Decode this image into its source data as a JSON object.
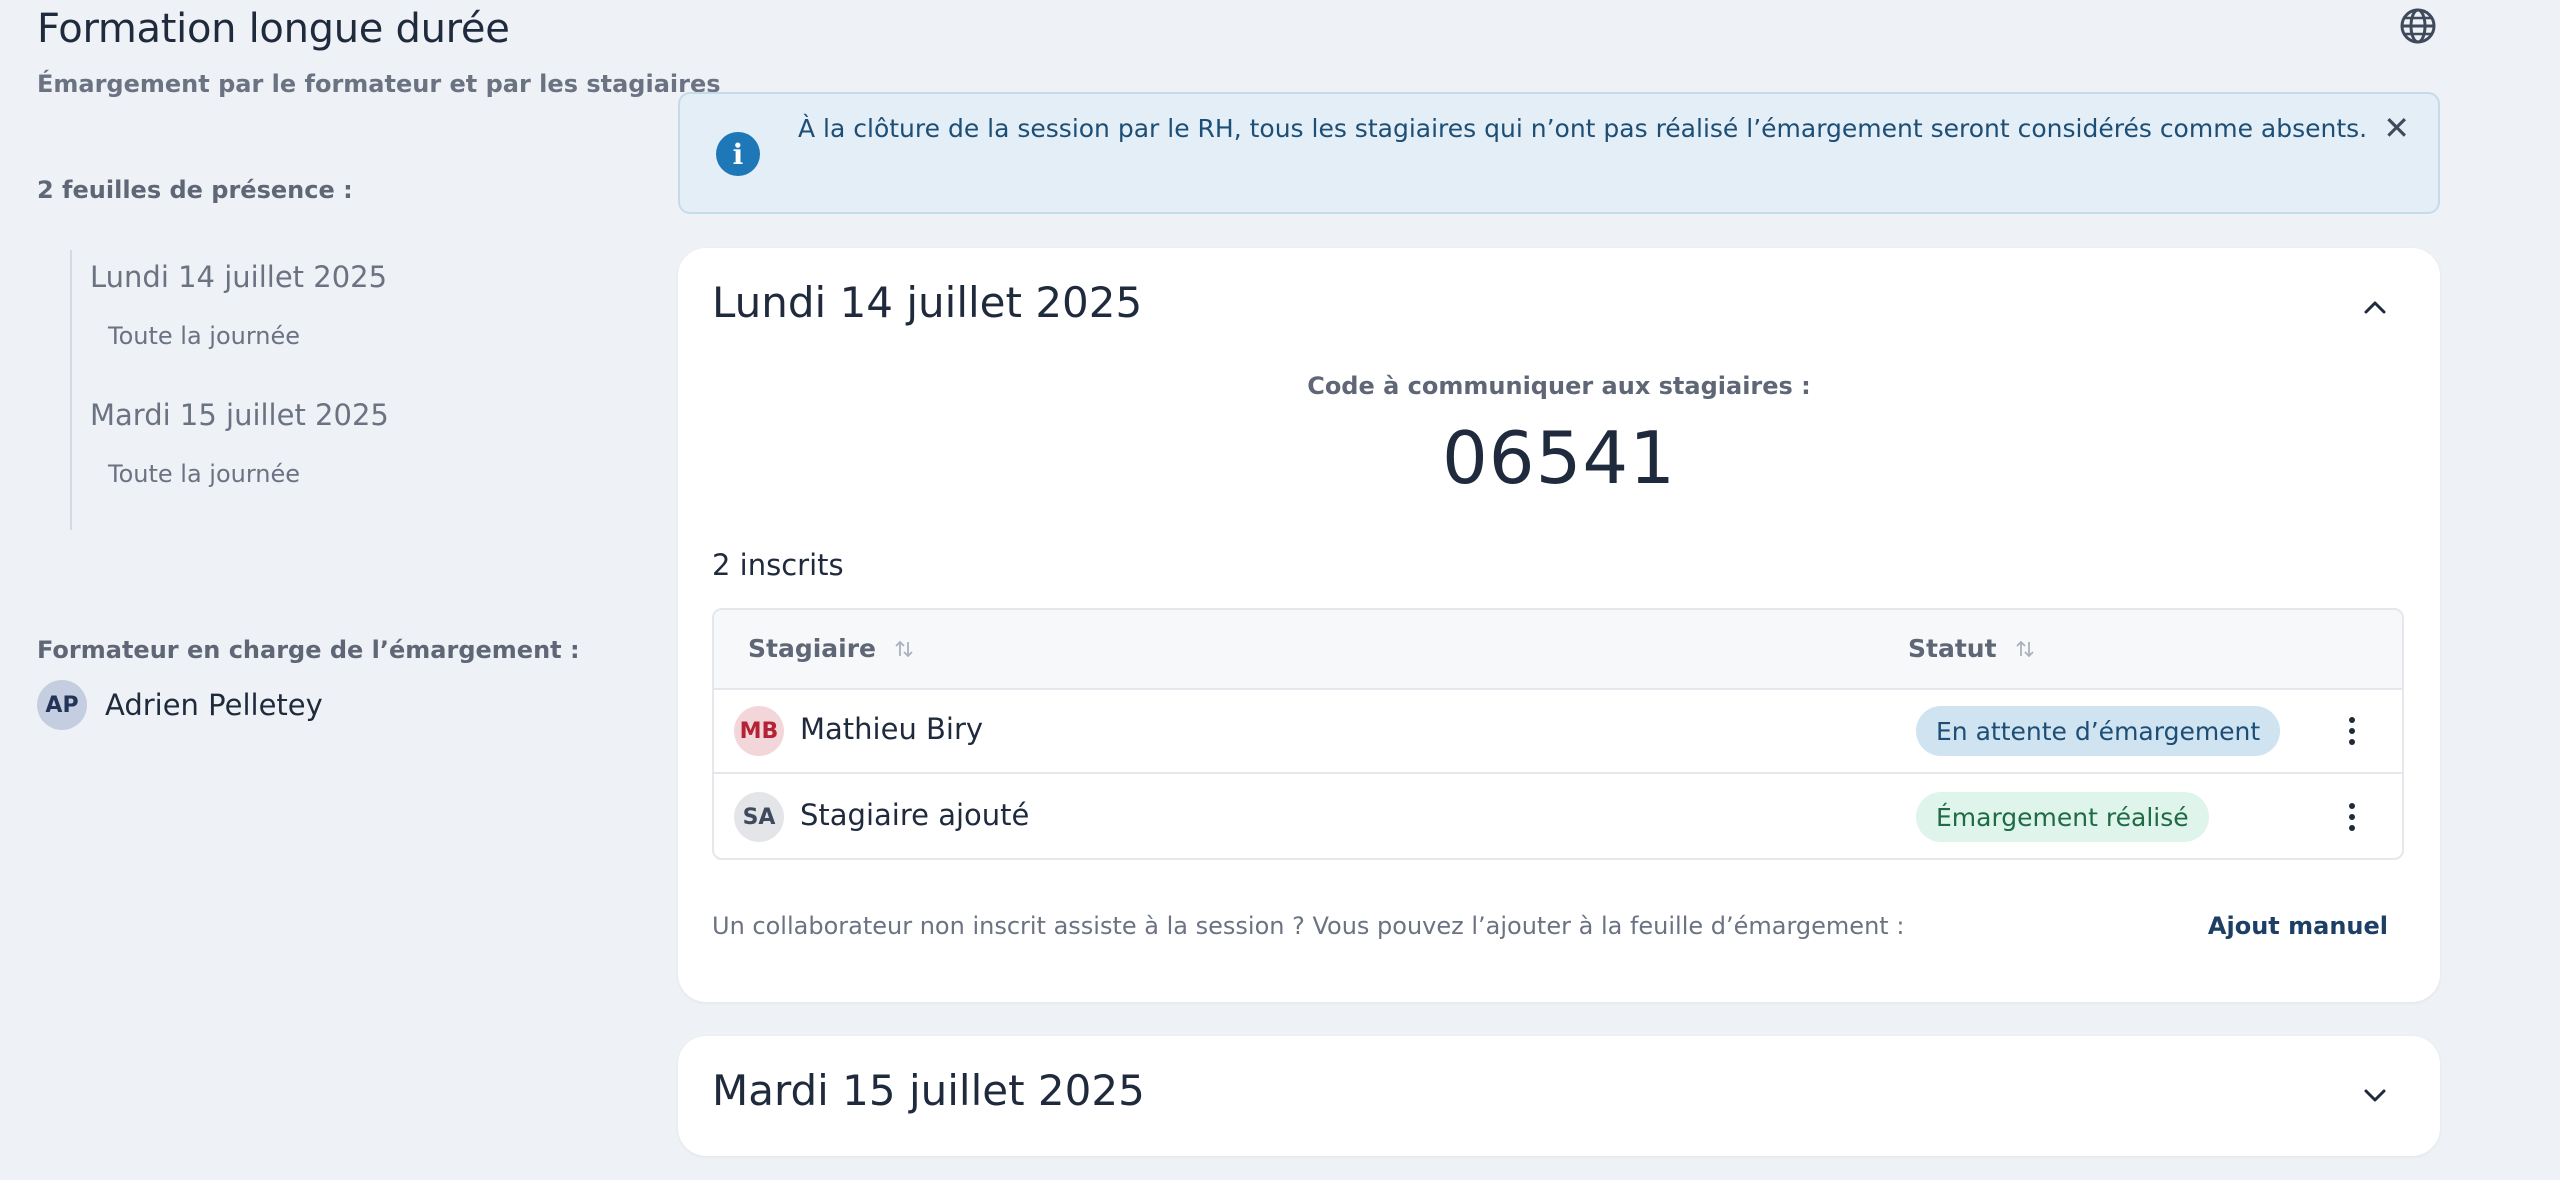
{
  "header": {
    "title": "Formation longue durée",
    "subtitle": "Émargement par le formateur et par les stagiaires",
    "globe_icon": "globe-icon"
  },
  "sidebar": {
    "sheets_label": "2 feuilles de présence :",
    "sheets": [
      {
        "day": "Lundi 14 juillet 2025",
        "period": "Toute la journée"
      },
      {
        "day": "Mardi 15 juillet 2025",
        "period": "Toute la journée"
      }
    ],
    "trainer_label": "Formateur en charge de l’émargement :",
    "trainer": {
      "initials": "AP",
      "name": "Adrien Pelletey"
    }
  },
  "banner": {
    "icon": "info-icon",
    "text": "À la clôture de la session par le RH, tous les stagiaires qui n’ont pas réalisé l’émargement seront considérés comme absents.",
    "close_icon": "close-icon",
    "close_glyph": "✕"
  },
  "sessions": [
    {
      "title": "Lundi 14 juillet 2025",
      "expanded": true,
      "code_label": "Code à communiquer aux stagiaires :",
      "code": "06541",
      "enrolled": "2 inscrits",
      "table": {
        "columns": [
          "Stagiaire",
          "Statut"
        ],
        "rows": [
          {
            "initials": "MB",
            "name": "Mathieu Biry",
            "status": "En attente d’émargement",
            "status_type": "pending"
          },
          {
            "initials": "SA",
            "name": "Stagiaire ajouté",
            "status": "Émargement réalisé",
            "status_type": "done"
          }
        ]
      },
      "footer_text": "Un collaborateur non inscrit assiste à la session ? Vous pouvez l’ajouter à la feuille d’émargement :",
      "footer_link": "Ajout manuel"
    },
    {
      "title": "Mardi 15 juillet 2025",
      "expanded": false
    }
  ],
  "colors": {
    "background": "#eef1f5",
    "info_accent": "#1e77b6",
    "pending_badge": "#cfe3f1",
    "done_badge": "#dff4ea"
  }
}
